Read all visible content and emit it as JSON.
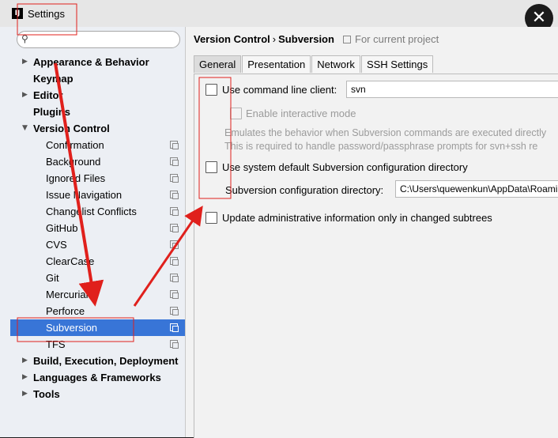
{
  "window": {
    "title": "Settings",
    "app_icon_text": "IJ"
  },
  "sidebar": {
    "search": {
      "value": "",
      "placeholder": ""
    },
    "items": [
      {
        "label": "Appearance & Behavior",
        "level": 0,
        "arrow": "▶"
      },
      {
        "label": "Keymap",
        "level": 0,
        "arrow": ""
      },
      {
        "label": "Editor",
        "level": 0,
        "arrow": "▶"
      },
      {
        "label": "Plugins",
        "level": 0,
        "arrow": ""
      },
      {
        "label": "Version Control",
        "level": 0,
        "arrow": "▼"
      },
      {
        "label": "Confirmation",
        "level": 1
      },
      {
        "label": "Background",
        "level": 1
      },
      {
        "label": "Ignored Files",
        "level": 1
      },
      {
        "label": "Issue Navigation",
        "level": 1
      },
      {
        "label": "Changelist Conflicts",
        "level": 1
      },
      {
        "label": "GitHub",
        "level": 1
      },
      {
        "label": "CVS",
        "level": 1
      },
      {
        "label": "ClearCase",
        "level": 1
      },
      {
        "label": "Git",
        "level": 1
      },
      {
        "label": "Mercurial",
        "level": 1
      },
      {
        "label": "Perforce",
        "level": 1
      },
      {
        "label": "Subversion",
        "level": 1,
        "selected": true
      },
      {
        "label": "TFS",
        "level": 1
      },
      {
        "label": "Build, Execution, Deployment",
        "level": 0,
        "arrow": "▶"
      },
      {
        "label": "Languages & Frameworks",
        "level": 0,
        "arrow": "▶"
      },
      {
        "label": "Tools",
        "level": 0,
        "arrow": "▶"
      }
    ]
  },
  "content": {
    "breadcrumb": {
      "parent": "Version Control",
      "separator": "›",
      "current": "Subversion"
    },
    "project_hint": "For current project",
    "tabs": [
      "General",
      "Presentation",
      "Network",
      "SSH Settings"
    ],
    "general": {
      "use_cmd_client_label": "Use command line client:",
      "cmd_client_value": "svn",
      "enable_interactive_label": "Enable interactive mode",
      "desc_line1": "Emulates the behavior when Subversion commands are executed directly",
      "desc_line2": "This is required to handle password/passphrase prompts for svn+ssh re",
      "use_system_default_label": "Use system default Subversion configuration directory",
      "config_dir_label": "Subversion configuration directory:",
      "config_dir_value": "C:\\Users\\quewenkun\\AppData\\Roaming\\Subversion",
      "update_admin_label": "Update administrative information only in changed subtrees"
    }
  },
  "colors": {
    "selection": "#3875d7",
    "annotation": "#e0201c"
  }
}
